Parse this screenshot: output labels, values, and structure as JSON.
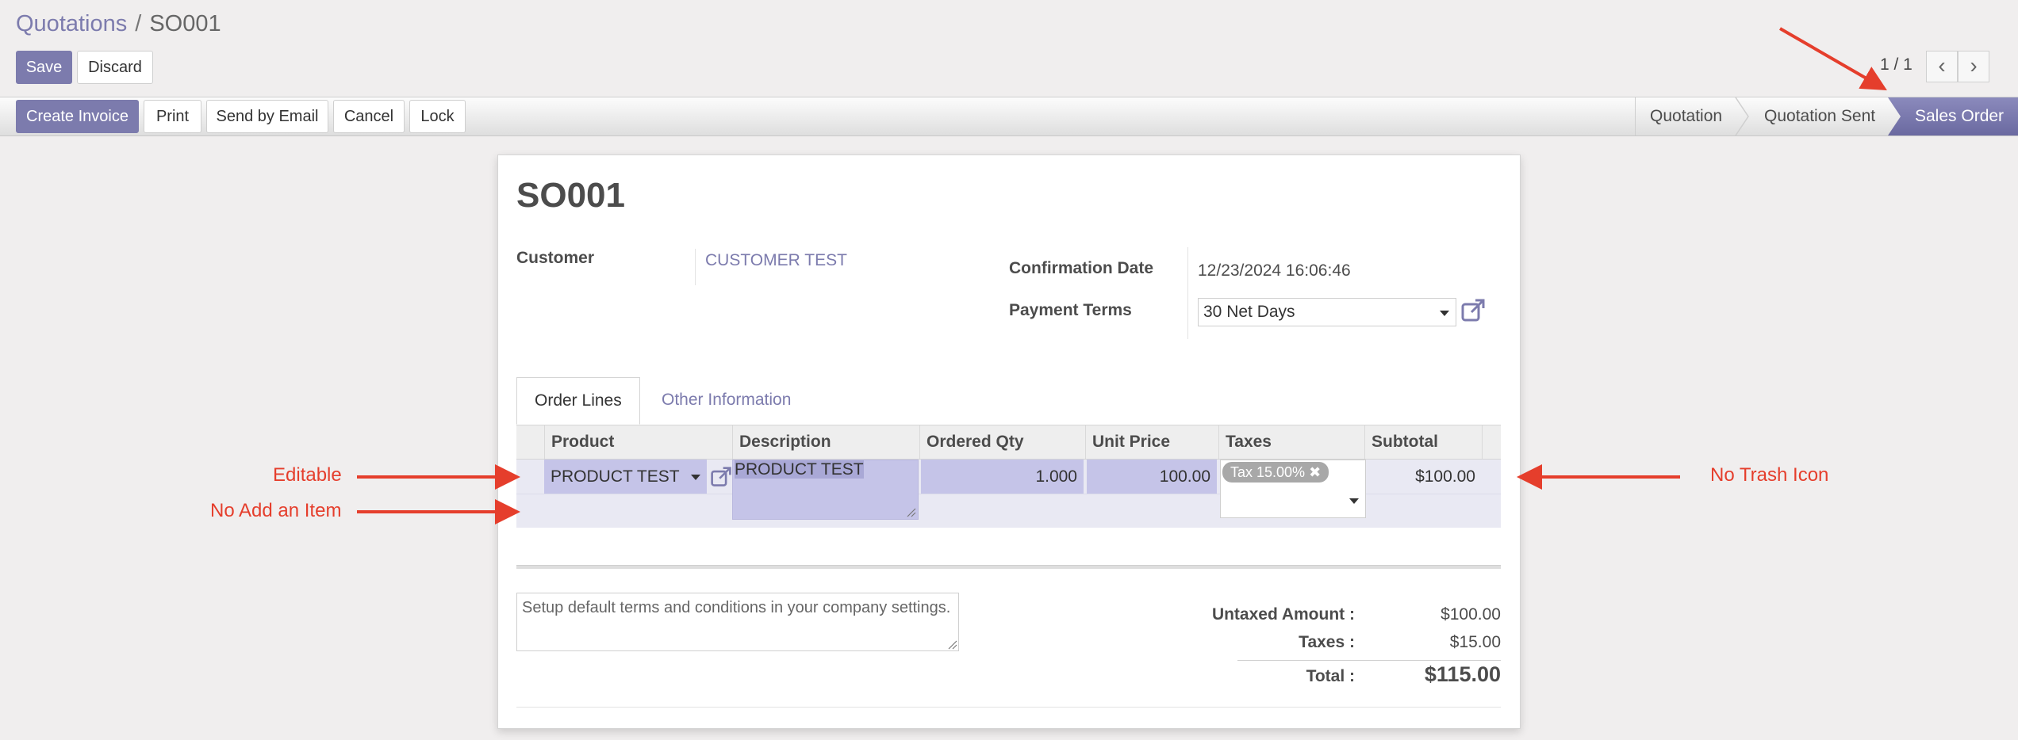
{
  "breadcrumb": {
    "parent": "Quotations",
    "separator": "/",
    "current": "SO001"
  },
  "toolbar": {
    "save": "Save",
    "discard": "Discard"
  },
  "pager": {
    "value": "1 / 1",
    "prev_icon": "chevron-left-icon",
    "next_icon": "chevron-right-icon"
  },
  "actions": {
    "create_invoice": "Create Invoice",
    "print": "Print",
    "send_email": "Send by Email",
    "cancel": "Cancel",
    "lock": "Lock"
  },
  "status_stages": [
    {
      "label": "Quotation",
      "active": false
    },
    {
      "label": "Quotation Sent",
      "active": false
    },
    {
      "label": "Sales Order",
      "active": true
    }
  ],
  "form": {
    "title": "SO001",
    "customer_label": "Customer",
    "customer_value": "CUSTOMER TEST",
    "confirmation_label": "Confirmation Date",
    "confirmation_value": "12/23/2024 16:06:46",
    "payment_terms_label": "Payment Terms",
    "payment_terms_value": "30 Net Days"
  },
  "tabs": {
    "order_lines": "Order Lines",
    "other_info": "Other Information"
  },
  "table": {
    "headers": [
      "Product",
      "Description",
      "Ordered Qty",
      "Unit Price",
      "Taxes",
      "Subtotal"
    ],
    "row": {
      "product": "PRODUCT TEST",
      "description": "PRODUCT TEST",
      "qty": "1.000",
      "unit_price": "100.00",
      "tax_tag": "Tax 15.00%",
      "subtotal": "$100.00"
    }
  },
  "terms_placeholder": "Setup default terms and conditions in your company settings.",
  "totals": {
    "untaxed_label": "Untaxed Amount :",
    "untaxed_value": "$100.00",
    "taxes_label": "Taxes :",
    "taxes_value": "$15.00",
    "total_label": "Total :",
    "total_value": "$115.00"
  },
  "annotations": {
    "editable": "Editable",
    "no_add": "No Add an Item",
    "no_trash": "No Trash Icon"
  },
  "colors": {
    "accent": "#7c7bad",
    "annotation": "#e53e2c",
    "highlight": "#c5c4e8"
  }
}
